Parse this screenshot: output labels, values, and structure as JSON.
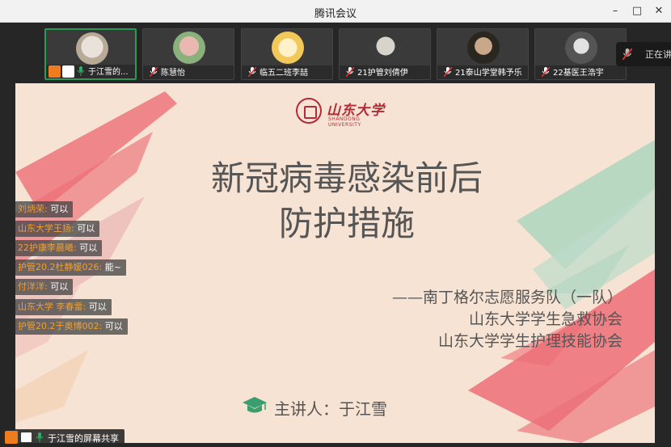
{
  "window": {
    "title": "腾讯会议",
    "minimize": "–",
    "maximize": "□",
    "close": "✕"
  },
  "participants": [
    {
      "name": "于江雪的...",
      "active": true
    },
    {
      "name": "陈慧怡"
    },
    {
      "name": "临五二班李喆"
    },
    {
      "name": "21护管刘倩伊"
    },
    {
      "name": "21泰山学堂韩予乐"
    },
    {
      "name": "22基医王浩宇"
    }
  ],
  "speaking_indicator": "正在讲",
  "slide": {
    "logo_cn": "山东大学",
    "logo_en": "SHANDONG UNIVERSITY",
    "title_line1": "新冠病毒感染前后",
    "title_line2": "防护措施",
    "org1": "——南丁格尔志愿服务队（一队）",
    "org2": "山东大学学生急救协会",
    "org3": "山东大学学生护理技能协会",
    "speaker": "主讲人：于江雪"
  },
  "chat": [
    {
      "who": "刘炳荣:",
      "msg": "可以"
    },
    {
      "who": "山东大学王扬:",
      "msg": "可以"
    },
    {
      "who": "22护康李晨曦:",
      "msg": "可以"
    },
    {
      "who": "护管20.2杜静媛026:",
      "msg": "能~"
    },
    {
      "who": "付洋洋:",
      "msg": "可以"
    },
    {
      "who": "山东大学 李春雷:",
      "msg": "可以"
    },
    {
      "who": "护管20.2于奥博002:",
      "msg": "可以"
    }
  ],
  "share_bar": {
    "label": "于江雪的屏幕共享"
  },
  "colors": {
    "host_badge": "#f07d1d",
    "active_border": "#2a9a55",
    "brand_red": "#b22b36",
    "slide_bg": "#f7e3d3"
  }
}
